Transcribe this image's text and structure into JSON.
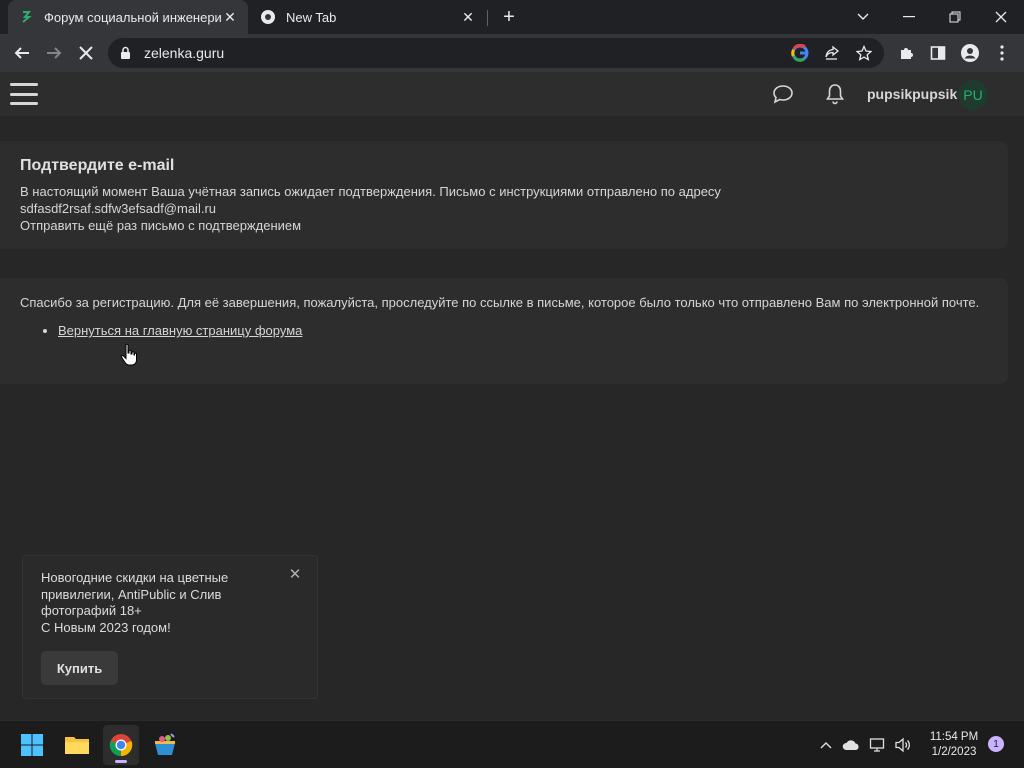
{
  "browser": {
    "tabs": [
      {
        "title": "Форум социальной инженерии",
        "active": true
      },
      {
        "title": "New Tab",
        "active": false
      }
    ],
    "url": "zelenka.guru"
  },
  "site_header": {
    "username": "pupsikpupsik",
    "avatar_initials": "PU"
  },
  "confirm_block": {
    "title": "Подтвердите e-mail",
    "line1": "В настоящий момент Ваша учётная запись ожидает подтверждения. Письмо с инструкциями отправлено по адресу",
    "email": "sdfasdf2rsaf.sdfw3efsadf@mail.ru",
    "resend_link": "Отправить ещё раз письмо с подтверждением"
  },
  "thanks_block": {
    "text": "Спасибо за регистрацию. Для её завершения, пожалуйста, проследуйте по ссылке в письме, которое было только что отправлено Вам по электронной почте.",
    "link": "Вернуться на главную страницу форума"
  },
  "promo": {
    "text": "Новогодние скидки на цветные привилегии, AntiPublic и Слив фотографий 18+",
    "greeting": "С Новым 2023 годом!",
    "button": "Купить"
  },
  "taskbar": {
    "time": "11:54 PM",
    "date": "1/2/2023",
    "notification_count": "1"
  },
  "colors": {
    "page_bg": "#272727",
    "block_bg": "#2d2d2d",
    "accent_green": "#2bad72"
  }
}
